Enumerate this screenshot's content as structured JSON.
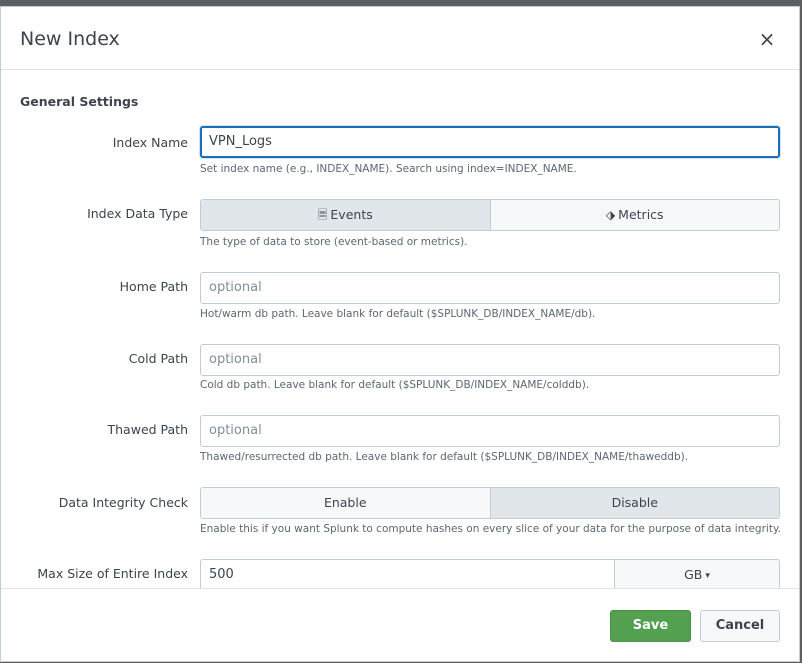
{
  "dialog": {
    "title": "New Index",
    "close_icon": "×"
  },
  "general": {
    "section_title": "General Settings",
    "index_name": {
      "label": "Index Name",
      "value": "VPN_Logs",
      "help": "Set index name (e.g., INDEX_NAME). Search using index=INDEX_NAME."
    },
    "data_type": {
      "label": "Index Data Type",
      "options": [
        {
          "label": "Events",
          "icon": "document-icon",
          "glyph": "🗏",
          "selected": true
        },
        {
          "label": "Metrics",
          "icon": "tag-icon",
          "glyph": "⬗",
          "selected": false
        }
      ],
      "help": "The type of data to store (event-based or metrics)."
    },
    "home_path": {
      "label": "Home Path",
      "placeholder": "optional",
      "help": "Hot/warm db path. Leave blank for default ($SPLUNK_DB/INDEX_NAME/db)."
    },
    "cold_path": {
      "label": "Cold Path",
      "placeholder": "optional",
      "help": "Cold db path. Leave blank for default ($SPLUNK_DB/INDEX_NAME/colddb)."
    },
    "thawed_path": {
      "label": "Thawed Path",
      "placeholder": "optional",
      "help": "Thawed/resurrected db path. Leave blank for default ($SPLUNK_DB/INDEX_NAME/thaweddb)."
    },
    "integrity": {
      "label": "Data Integrity Check",
      "options": [
        {
          "label": "Enable",
          "selected": false
        },
        {
          "label": "Disable",
          "selected": true
        }
      ],
      "help": "Enable this if you want Splunk to compute hashes on every slice of your data for the purpose of data integrity."
    },
    "max_size": {
      "label": "Max Size of Entire Index",
      "value": "500",
      "unit": "GB",
      "caret": "▾"
    }
  },
  "footer": {
    "save_label": "Save",
    "cancel_label": "Cancel"
  },
  "colors": {
    "focus_border": "#1a6fb6",
    "save_green": "#53a051",
    "text": "#3c444d"
  }
}
